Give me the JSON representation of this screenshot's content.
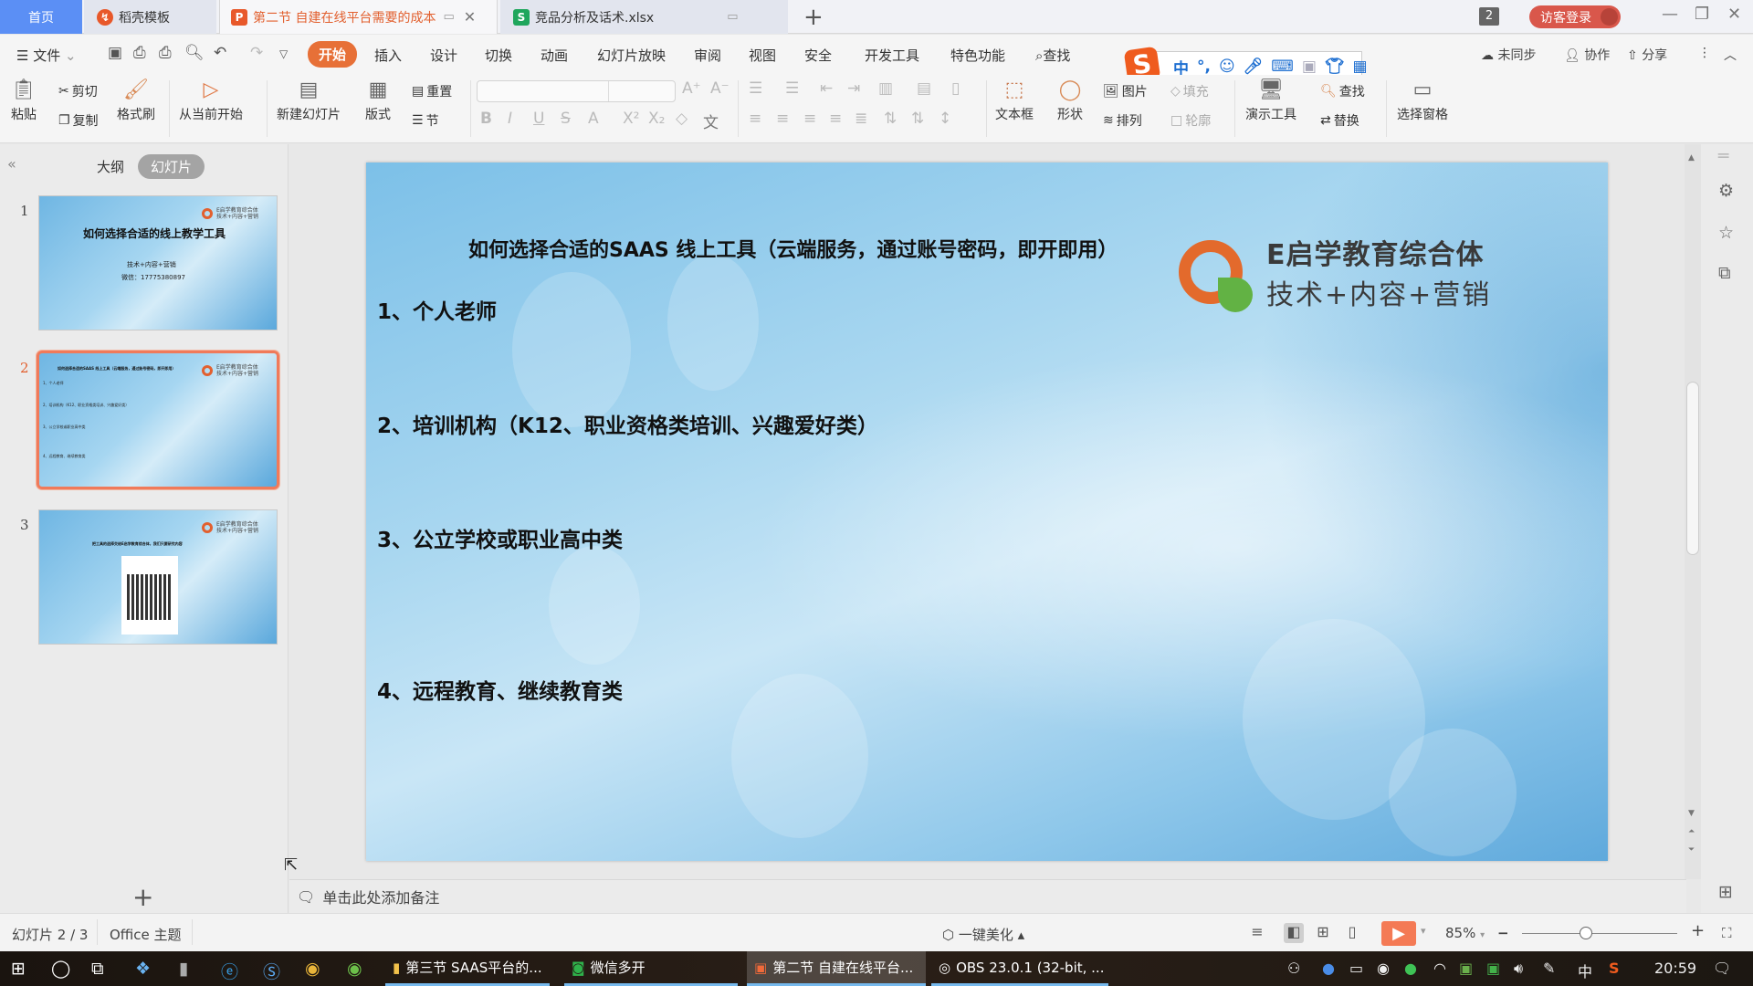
{
  "tabs": {
    "home": "首页",
    "items": [
      {
        "label": "稻壳模板",
        "icon": "daoke-icon",
        "color": "#e8582a"
      },
      {
        "label": "第二节  自建在线平台需要的成本",
        "icon": "ppt-icon",
        "color": "#e8582a",
        "active": true
      },
      {
        "label": "竞品分析及话术.xlsx",
        "icon": "sheet-icon",
        "color": "#1fa65c"
      }
    ],
    "window_count": "2",
    "guest_login": "访客登录"
  },
  "menu": {
    "file": "文件",
    "items": [
      "开始",
      "插入",
      "设计",
      "切换",
      "动画",
      "幻灯片放映",
      "审阅",
      "视图",
      "安全",
      "开发工具",
      "特色功能"
    ],
    "active": "开始",
    "search": "查找",
    "sync": "未同步",
    "collab": "协作",
    "share": "分享"
  },
  "ime": {
    "mode": "中",
    "punct": "°,"
  },
  "ribbon": {
    "paste": "粘贴",
    "cut": "剪切",
    "copy": "复制",
    "format_painter": "格式刷",
    "from_current": "从当前开始",
    "new_slide": "新建幻灯片",
    "layout": "版式",
    "reset": "重置",
    "section": "节",
    "font_name": "",
    "font_size": "",
    "textbox": "文本框",
    "shape": "形状",
    "picture": "图片",
    "arrange": "排列",
    "fill": "填充",
    "outline": "轮廓",
    "present_tools": "演示工具",
    "find": "查找",
    "replace": "替换",
    "selection_pane": "选择窗格"
  },
  "left_panel": {
    "tab_outline": "大纲",
    "tab_slides": "幻灯片",
    "active_tab": "幻灯片",
    "slides": [
      {
        "num": "1",
        "title": "如何选择合适的线上教学工具",
        "lines": [
          "技术+内容+营销",
          "微信：17775380897"
        ]
      },
      {
        "num": "2",
        "title": "如何选择合适的SAAS 线上工具（云端服务，通过账号密码，即开即用）",
        "lines": [
          "1、个人老师",
          "2、培训机构（K12、职业资格类培训、兴趣爱好类）",
          "3、公立学校或职业高中类",
          "4、远程教育、继续教育类"
        ],
        "active": true
      },
      {
        "num": "3",
        "title": "把工具的选择交给E启学教育综合体，我们只要研究内容",
        "lines": []
      }
    ]
  },
  "slide": {
    "title": "如何选择合适的SAAS 线上工具（云端服务，通过账号密码，即开即用）",
    "items": [
      "1、个人老师",
      "2、培训机构（K12、职业资格类培训、兴趣爱好类）",
      "3、公立学校或职业高中类",
      "4、远程教育、继续教育类"
    ],
    "logo_line1": "E启学教育综合体",
    "logo_line2": "技术+内容+营销",
    "logo_colors": {
      "ring": "#e36a2c",
      "leaf": "#62b244"
    }
  },
  "notes_placeholder": "单击此处添加备注",
  "status": {
    "slide_pos": "幻灯片 2 / 3",
    "theme": "Office 主题",
    "beautify": "一键美化",
    "zoom": "85%"
  },
  "taskbar": {
    "apps": [
      {
        "label": "第三节 SAAS平台的...",
        "icon": "folder-icon"
      },
      {
        "label": "微信多开",
        "icon": "wechat-icon"
      },
      {
        "label": "第二节  自建在线平台...",
        "icon": "wps-ppt-icon",
        "active": true
      },
      {
        "label": "OBS 23.0.1 (32-bit, ...",
        "icon": "obs-icon"
      }
    ],
    "ime": "中",
    "clock": "20:59"
  }
}
